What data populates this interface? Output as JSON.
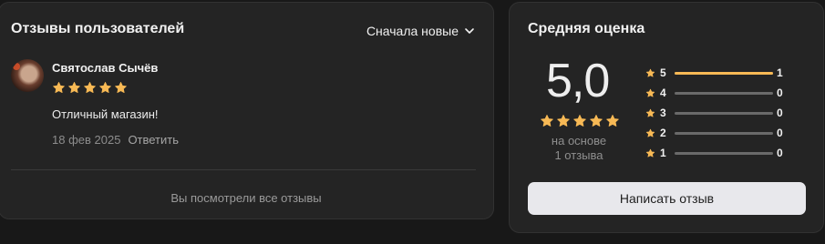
{
  "reviews": {
    "title": "Отзывы пользователей",
    "sort_label": "Сначала новые",
    "items": [
      {
        "author": "Святослав Сычёв",
        "stars": 5,
        "text": "Отличный магазин!",
        "date": "18 фев 2025",
        "reply_label": "Ответить"
      }
    ],
    "all_seen_label": "Вы посмотрели все отзывы"
  },
  "rating": {
    "title": "Средняя оценка",
    "score": "5,0",
    "stars": 5,
    "based_on_line1": "на основе",
    "based_on_line2": "1 отзыва",
    "distribution": [
      {
        "level": "5",
        "count": "1",
        "fraction": 1.0
      },
      {
        "level": "4",
        "count": "0",
        "fraction": 0
      },
      {
        "level": "3",
        "count": "0",
        "fraction": 0
      },
      {
        "level": "2",
        "count": "0",
        "fraction": 0
      },
      {
        "level": "1",
        "count": "0",
        "fraction": 0
      }
    ],
    "write_label": "Написать отзыв"
  },
  "colors": {
    "star": "#f7b955",
    "accent_bar": "#f7b955",
    "button_bg": "#e8e8ec"
  }
}
